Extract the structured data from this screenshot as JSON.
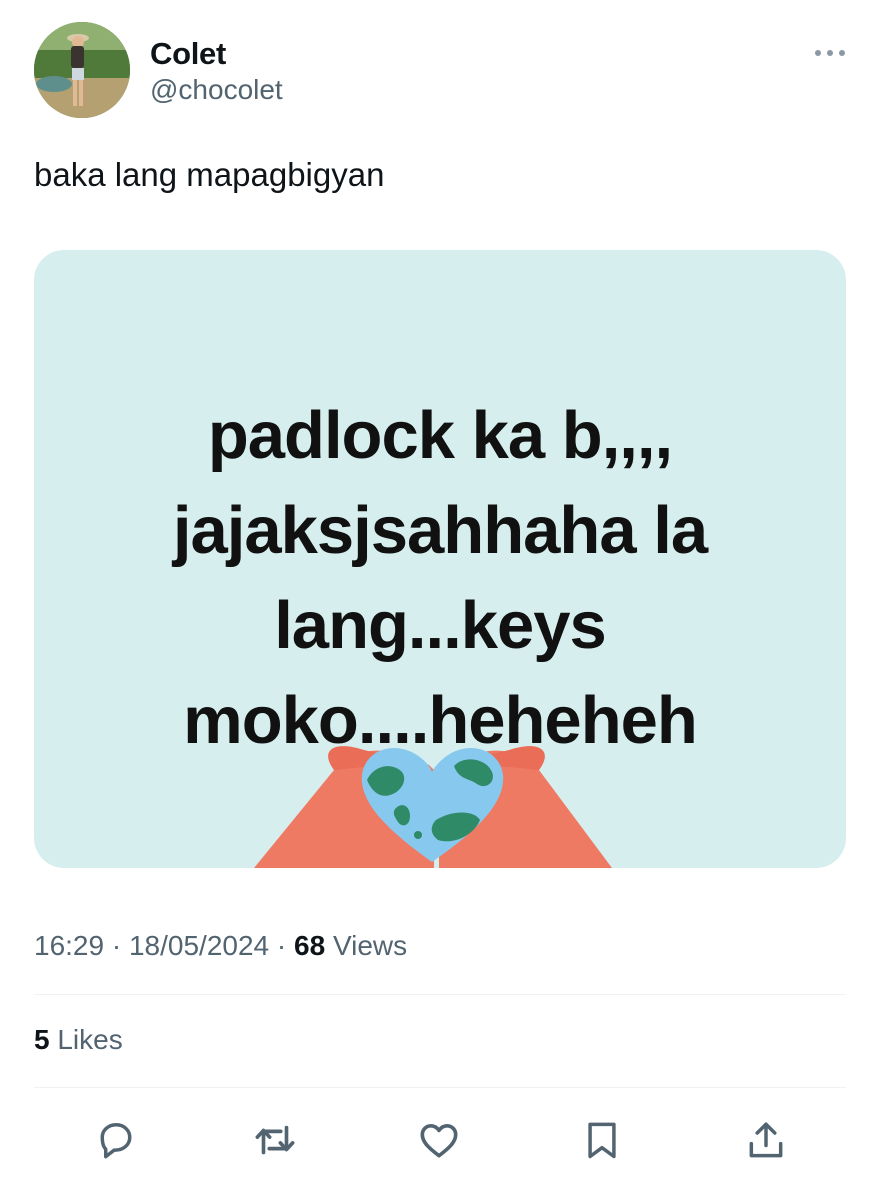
{
  "user": {
    "display_name": "Colet",
    "handle": "@chocolet",
    "avatar_icon": "profile-photo"
  },
  "tweet": {
    "text": "baka lang mapagbigyan",
    "media": {
      "lines": [
        "padlock ka b,,,,",
        "jajaksjsahhaha la",
        "lang...keys",
        "moko....heheheh"
      ]
    },
    "time": "16:29",
    "separator": "·",
    "date": "18/05/2024",
    "views_count": "68",
    "views_label": "Views",
    "likes_count": "5",
    "likes_label": "Likes"
  },
  "actions": [
    {
      "name": "reply",
      "icon": "reply-icon"
    },
    {
      "name": "retweet",
      "icon": "retweet-icon"
    },
    {
      "name": "like",
      "icon": "heart-icon"
    },
    {
      "name": "bookmark",
      "icon": "bookmark-icon"
    },
    {
      "name": "share",
      "icon": "share-icon"
    }
  ],
  "colors": {
    "text_primary": "#0f1419",
    "text_secondary": "#536471",
    "icon": "#536471",
    "divider": "#eff3f4",
    "media_background": "#d6efee",
    "hands": "#ef7a63",
    "globe_water": "#87c9ee",
    "globe_land": "#2f8a67"
  }
}
